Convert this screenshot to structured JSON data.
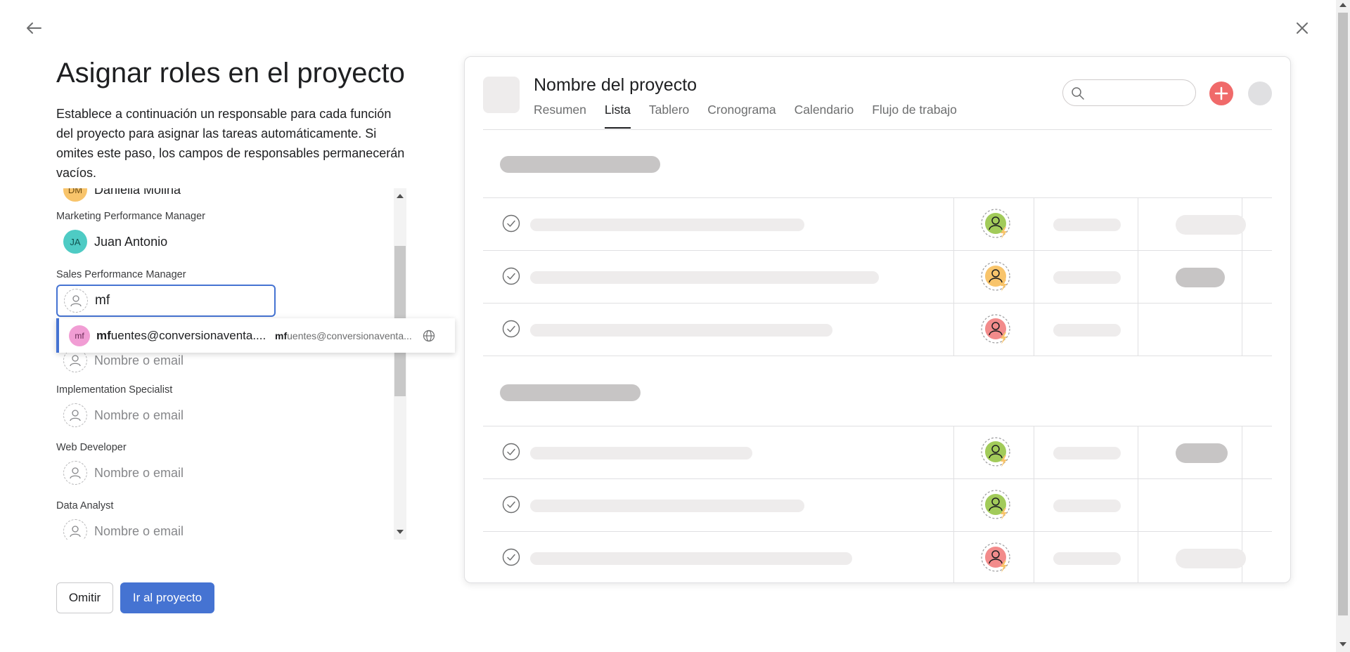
{
  "header": {
    "title": "Asignar roles en el proyecto",
    "description": "Establece a continuación un responsable para cada función del proyecto para asignar las tareas automáticamente. Si omites este paso, los campos de responsables permanecerán vacíos."
  },
  "roles": {
    "partial_assignee": {
      "initials": "DM",
      "name": "Daniella Molina"
    },
    "marketing": {
      "label": "Marketing Performance Manager",
      "initials": "JA",
      "name": "Juan Antonio"
    },
    "sales": {
      "label": "Sales Performance Manager",
      "input_value": "mf"
    },
    "hidden_row": {
      "placeholder": "Nombre o email"
    },
    "implementation": {
      "label": "Implementation Specialist",
      "placeholder": "Nombre o email"
    },
    "web": {
      "label": "Web Developer",
      "placeholder": "Nombre o email"
    },
    "data": {
      "label": "Data Analyst",
      "placeholder": "Nombre o email"
    }
  },
  "dropdown": {
    "initials": "mf",
    "name_bold": "mf",
    "name_rest": "uentes@conversionaventa....",
    "email_bold": "mf",
    "email_rest": "uentes@conversionaventa...",
    "icon": "globe-icon"
  },
  "buttons": {
    "omit": "Omitir",
    "go": "Ir al proyecto"
  },
  "preview": {
    "project_title": "Nombre del proyecto",
    "tabs": [
      "Resumen",
      "Lista",
      "Tablero",
      "Cronograma",
      "Calendario",
      "Flujo de trabajo"
    ],
    "active_tab": "Lista",
    "colors": {
      "accent": "#4573d2",
      "plus": "#f06a6a",
      "green": "#a2cb5a",
      "yellow": "#f8c46b",
      "red": "#f28b8b",
      "lightning": "#f8c46b"
    }
  }
}
